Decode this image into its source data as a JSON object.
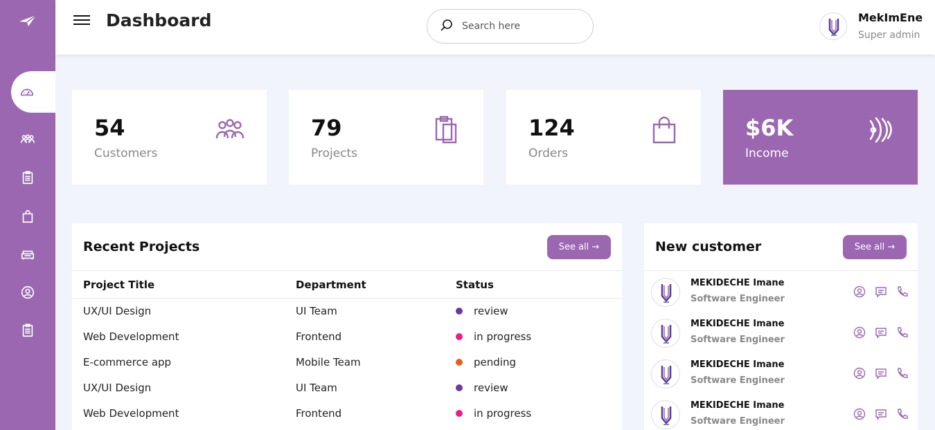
{
  "colors": {
    "accent": "#9b67b1",
    "review": "#6b3aa0",
    "in_progress": "#ee1b8a",
    "pending": "#f25a1c"
  },
  "sidebar": {
    "logo_icon": "paper-plane-icon",
    "items": [
      {
        "icon": "dashboard-gauge-icon",
        "active": true
      },
      {
        "icon": "users-icon"
      },
      {
        "icon": "clipboard-icon"
      },
      {
        "icon": "shopping-bag-icon"
      },
      {
        "icon": "sofa-icon"
      },
      {
        "icon": "user-circle-icon"
      },
      {
        "icon": "clipboard-list-icon"
      }
    ]
  },
  "header": {
    "title": "Dashboard",
    "search_placeholder": "Search here",
    "user_name": "MekImEne",
    "user_role": "Super admin"
  },
  "stats": [
    {
      "value": "54",
      "label": "Customers",
      "icon": "users-icon"
    },
    {
      "value": "79",
      "label": "Projects",
      "icon": "clipboard-icon"
    },
    {
      "value": "124",
      "label": "Orders",
      "icon": "shopping-bag-icon"
    },
    {
      "value": "$6K",
      "label": "Income",
      "icon": "wave-icon"
    }
  ],
  "recent_projects": {
    "title": "Recent Projects",
    "see_all": "See all →",
    "columns": [
      "Project Title",
      "Department",
      "Status"
    ],
    "rows": [
      {
        "title": "UX/UI Design",
        "department": "UI Team",
        "status": "review",
        "status_color": "#6b3aa0"
      },
      {
        "title": "Web Development",
        "department": "Frontend",
        "status": "in progress",
        "status_color": "#ee1b8a"
      },
      {
        "title": "E-commerce app",
        "department": "Mobile Team",
        "status": "pending",
        "status_color": "#f25a1c"
      },
      {
        "title": "UX/UI Design",
        "department": "UI Team",
        "status": "review",
        "status_color": "#6b3aa0"
      },
      {
        "title": "Web Development",
        "department": "Frontend",
        "status": "in progress",
        "status_color": "#ee1b8a"
      }
    ]
  },
  "new_customer": {
    "title": "New customer",
    "see_all": "See all →",
    "rows": [
      {
        "name": "MEKIDECHE Imane",
        "role": "Software Engineer"
      },
      {
        "name": "MEKIDECHE Imane",
        "role": "Software Engineer"
      },
      {
        "name": "MEKIDECHE Imane",
        "role": "Software Engineer"
      },
      {
        "name": "MEKIDECHE Imane",
        "role": "Software Engineer"
      }
    ]
  }
}
